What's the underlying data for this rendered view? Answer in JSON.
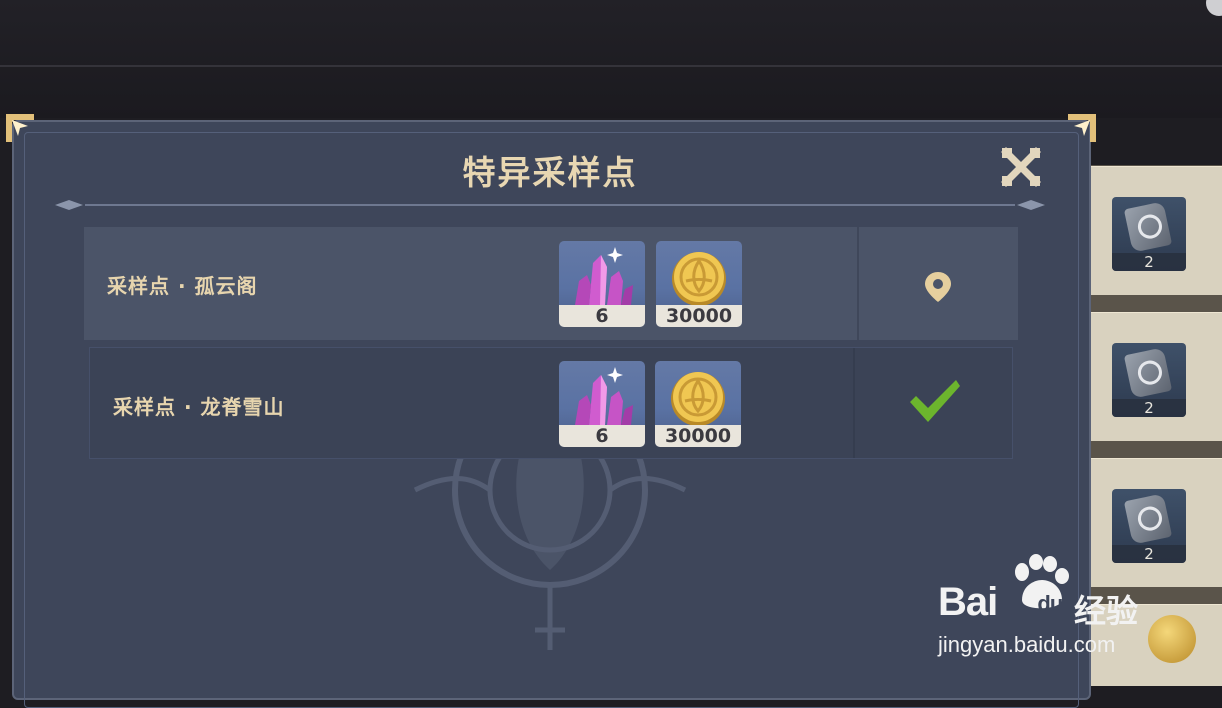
{
  "title": "特异采样点",
  "rows": [
    {
      "label": "采样点 · 孤云阁",
      "rewards": [
        {
          "icon": "crystal-icon",
          "qty": "6"
        },
        {
          "icon": "mora-coin-icon",
          "qty": "30000"
        }
      ],
      "action": "map-pin-icon"
    },
    {
      "label": "采样点 · 龙脊雪山",
      "rewards": [
        {
          "icon": "crystal-icon",
          "qty": "6"
        },
        {
          "icon": "mora-coin-icon",
          "qty": "30000"
        }
      ],
      "action": "checkmark-icon"
    }
  ],
  "side_items": [
    {
      "icon": "artifact-icon",
      "qty": "2"
    },
    {
      "icon": "artifact-icon",
      "qty": "2"
    },
    {
      "icon": "artifact-icon",
      "qty": "2"
    }
  ],
  "watermark": {
    "brand_left": "Bai",
    "brand_right": "经验",
    "du": "du",
    "url": "jingyan.baidu.com"
  },
  "colors": {
    "panel": "#3e465a",
    "title": "#e8d7b2",
    "check": "#6cb52d"
  }
}
